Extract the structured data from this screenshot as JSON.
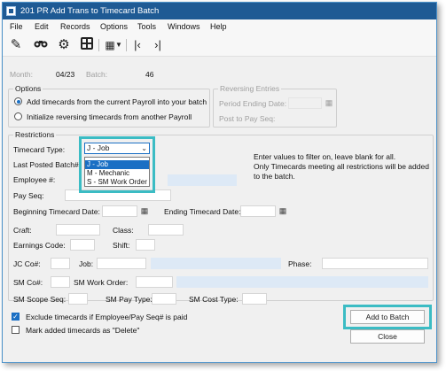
{
  "window": {
    "title": "201 PR Add Trans to Timecard Batch"
  },
  "menu": [
    "File",
    "Edit",
    "Records",
    "Options",
    "Tools",
    "Windows",
    "Help"
  ],
  "toolbar_icons": [
    "edit-icon",
    "binoculars-icon",
    "gear-icon",
    "grid-icon",
    "dropdown-icon",
    "first-record-icon",
    "last-record-icon"
  ],
  "header": {
    "month_label": "Month:",
    "month_value": "04/23",
    "batch_label": "Batch:",
    "batch_value": "46"
  },
  "options": {
    "title": "Options",
    "radio_add": "Add timecards from the current Payroll into your batch",
    "radio_reverse": "Initialize reversing timecards from another Payroll"
  },
  "reversing": {
    "title": "Reversing Entries",
    "period_ending_label": "Period Ending Date:",
    "post_to_pay_seq_label": "Post to Pay Seq:"
  },
  "restrictions": {
    "title": "Restrictions",
    "timecard_type_label": "Timecard Type:",
    "timecard_type_value": "J - Job",
    "timecard_type_options": [
      "J - Job",
      "M - Mechanic",
      "S - SM Work Order"
    ],
    "last_posted_batch_label": "Last Posted Batch#:",
    "employee_label": "Employee #:",
    "pay_seq_label": "Pay Seq:",
    "beginning_timecard_date_label": "Beginning Timecard Date:",
    "ending_timecard_date_label": "Ending Timecard Date:",
    "craft_label": "Craft:",
    "class_label": "Class:",
    "earnings_code_label": "Earnings Code:",
    "shift_label": "Shift:",
    "jc_co_label": "JC Co#:",
    "job_label": "Job:",
    "phase_label": "Phase:",
    "sm_co_label": "SM Co#:",
    "sm_work_order_label": "SM Work Order:",
    "sm_scope_seq_label": "SM Scope Seq:",
    "sm_pay_type_label": "SM Pay Type:",
    "sm_cost_type_label": "SM Cost Type:",
    "note_line1": "Enter values to filter on, leave blank for all.",
    "note_line2": "Only Timecards meeting all restrictions will be added",
    "note_line3": "to the batch."
  },
  "bottom": {
    "exclude_label": "Exclude timecards if Employee/Pay Seq# is paid",
    "exclude_checked": true,
    "mark_label": "Mark added timecards as \"Delete\"",
    "mark_checked": false,
    "add_button": "Add to Batch",
    "close_button": "Close"
  },
  "colors": {
    "titlebar": "#1e5a94",
    "highlight": "#3bbcc4",
    "selection": "#1a6fc4",
    "field_blue": "#dde9f6"
  }
}
